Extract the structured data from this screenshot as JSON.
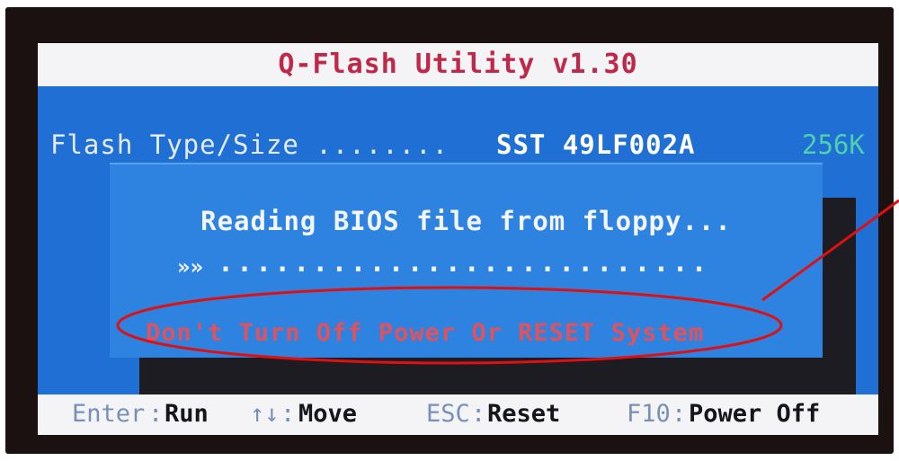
{
  "title": "Q-Flash Utility v1.30",
  "flash": {
    "label": "Flash Type/Size ........",
    "chip": "SST 49LF002A",
    "size": "256K"
  },
  "dialog": {
    "message": "Reading BIOS file from floppy...",
    "progress_arrows": "»»",
    "progress_dots": "..........................",
    "warning": "Don't Turn Off Power Or RESET System"
  },
  "keys": [
    {
      "key": "Enter",
      "action": "Run"
    },
    {
      "key": "↑↓",
      "action": "Move"
    },
    {
      "key": "ESC",
      "action": "Reset"
    },
    {
      "key": "F10",
      "action": "Power Off"
    }
  ],
  "colors": {
    "background": "#1f6fd4",
    "title_text": "#c0284a",
    "size_text": "#4fd0ad",
    "warning_text": "#e0525e",
    "annotation": "#e01010"
  }
}
